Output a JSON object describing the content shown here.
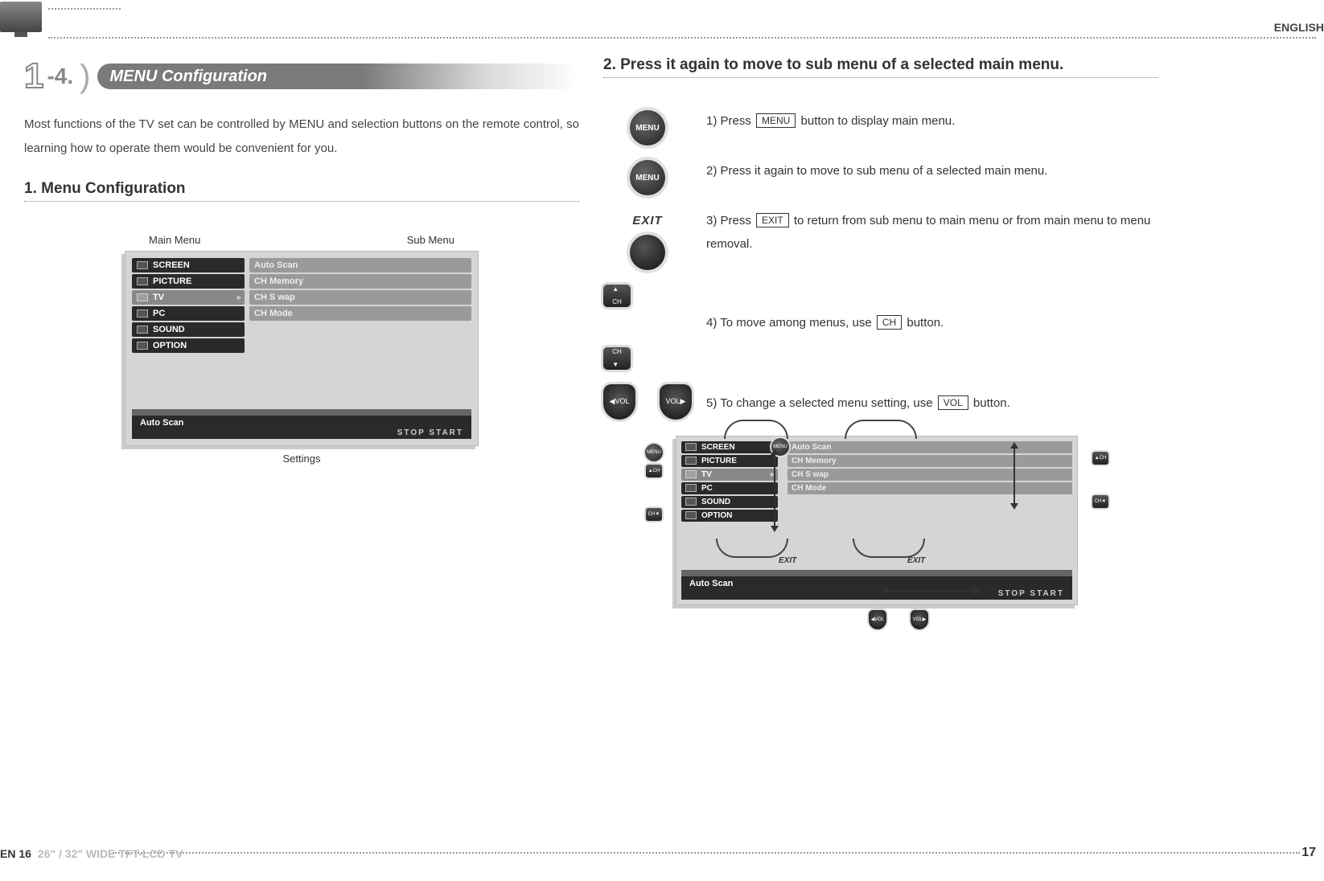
{
  "language": "ENGLISH",
  "section_number": "1-4.",
  "heading_bar": "MENU Configuration",
  "intro_text": "Most functions of the TV set can be controlled by MENU and selection buttons on the remote control, so learning how to operate them would be convenient for you.",
  "sub1_title": "1. Menu Configuration",
  "menu_labels": {
    "main": "Main Menu",
    "sub": "Sub Menu",
    "settings": "Settings"
  },
  "main_menu": [
    "SCREEN",
    "PICTURE",
    "TV",
    "PC",
    "SOUND",
    "OPTION"
  ],
  "sub_menu": [
    "Auto Scan",
    "CH Memory",
    "CH S wap",
    "CH Mode"
  ],
  "footer_setting": "Auto Scan",
  "footer_actions": "STOP   START",
  "sub2_title": "2. Press it again to move to sub menu of a selected main menu.",
  "buttons": {
    "menu": "MENU",
    "exit": "EXIT",
    "ch_up": "▲\nCH",
    "ch_down": "CH\n▼",
    "vol_left": "◀VOL",
    "vol_right": "VOL▶",
    "key_menu": "MENU",
    "key_exit": "EXIT",
    "key_ch": "CH",
    "key_vol": "VOL"
  },
  "steps": {
    "s1a": "1) Press ",
    "s1b": " button to display main menu.",
    "s2": "2) Press it again to move to sub menu of a selected main menu.",
    "s3a": "3) Press ",
    "s3b": " to return from sub menu to main menu or from main menu to menu removal.",
    "s4a": "4) To move among menus, use ",
    "s4b": " button.",
    "s5a": "5) To change a selected menu setting, use ",
    "s5b": " button."
  },
  "page_left_num": "EN 16",
  "page_left_model": "26\" / 32\" WIDE TFT-LCD TV",
  "page_right_num": "17"
}
